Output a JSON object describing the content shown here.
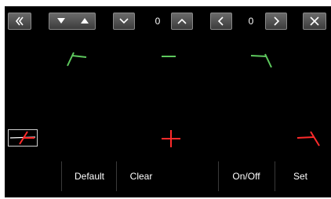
{
  "toolbar": {
    "left_value": "0",
    "right_value": "0"
  },
  "bottom_bar": {
    "default_label": "Default",
    "clear_label": "Clear",
    "onoff_label": "On/Off",
    "set_label": "Set"
  },
  "colors": {
    "green": "#5ec95e",
    "red": "#ff2b2b",
    "button_gray": "#5a5a5a"
  },
  "icons": {
    "back": "double-chevron-left-icon",
    "close": "x-close-icon"
  }
}
